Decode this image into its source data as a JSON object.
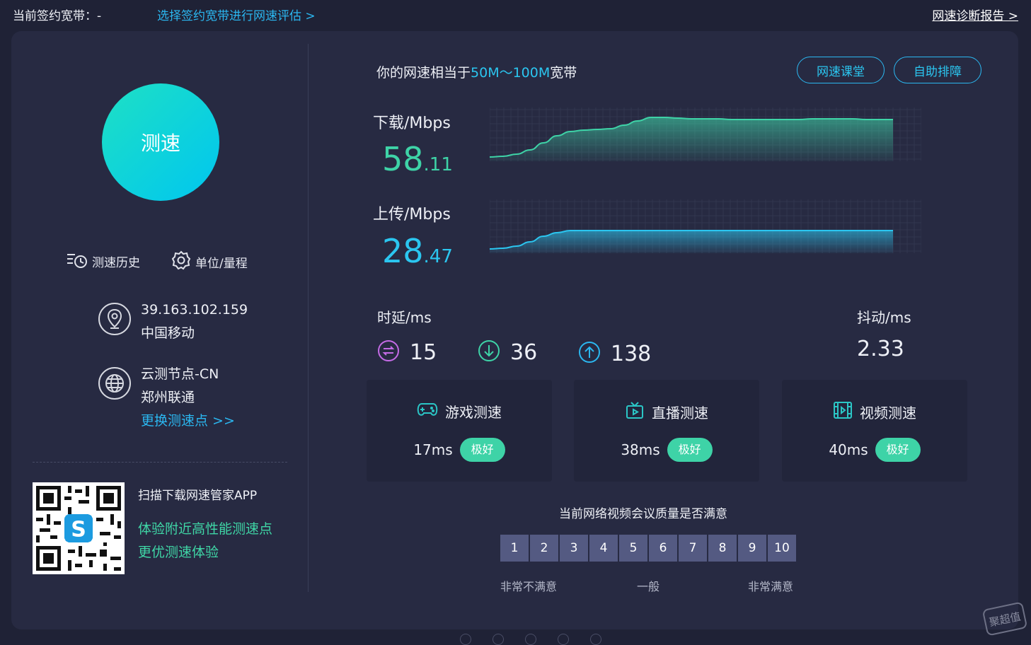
{
  "header": {
    "contract_label": "当前签约宽带：-",
    "select_link": "选择签约宽带进行网速评估 >",
    "report_link": "网速诊断报告 >"
  },
  "left": {
    "speed_button": "测速",
    "history_label": "测速历史",
    "units_label": "单位/量程",
    "ip": "39.163.102.159",
    "isp": "中国移动",
    "node_name": "云测节点-CN",
    "node_city": "郑州联通",
    "change_node": "更换测速点 >>",
    "qr_title": "扫描下载网速管家APP",
    "qr_line1": "体验附近高性能测速点",
    "qr_line2": "更优测速体验"
  },
  "right": {
    "equiv_prefix": "你的网速相当于",
    "equiv_value": "50M～100M",
    "equiv_suffix": "宽带",
    "btn_class": "网速课堂",
    "btn_troubleshoot": "自助排障",
    "download_label": "下载/Mbps",
    "download_int": "58",
    "download_dec": ".11",
    "upload_label": "上传/Mbps",
    "upload_int": "28",
    "upload_dec": ".47",
    "latency_label": "时延/ms",
    "latency_idle": "15",
    "latency_down": "36",
    "latency_up": "138",
    "jitter_label": "抖动/ms",
    "jitter_value": "2.33"
  },
  "scenarios": [
    {
      "title": "游戏测速",
      "value": "17ms",
      "grade": "极好"
    },
    {
      "title": "直播测速",
      "value": "38ms",
      "grade": "极好"
    },
    {
      "title": "视频测速",
      "value": "40ms",
      "grade": "极好"
    }
  ],
  "survey": {
    "question": "当前网络视频会议质量是否满意",
    "scores": [
      "1",
      "2",
      "3",
      "4",
      "5",
      "6",
      "7",
      "8",
      "9",
      "10"
    ],
    "low_label": "非常不满意",
    "mid_label": "一般",
    "high_label": "非常满意"
  },
  "colors": {
    "accent_blue": "#2bb7f0",
    "download_green": "#3ed3a7",
    "upload_blue": "#2bc6f0",
    "badge_green": "#3ed3a7"
  },
  "chart_data": [
    {
      "type": "area",
      "series": [
        {
          "values": [
            2,
            3,
            6,
            12,
            22,
            32,
            38,
            40,
            41,
            42,
            47,
            53,
            58,
            58,
            57,
            56,
            56,
            56,
            55,
            55,
            55,
            55,
            55,
            55,
            56,
            56,
            56,
            56,
            55,
            55,
            55
          ]
        }
      ]
    },
    {
      "type": "area",
      "series": [
        {
          "values": [
            2,
            3,
            6,
            12,
            20,
            25,
            28,
            28,
            28,
            28,
            28,
            28,
            28,
            28,
            28,
            28,
            28,
            28,
            28,
            28,
            28,
            28,
            28,
            28,
            28,
            28,
            28,
            28,
            28,
            28,
            28
          ]
        }
      ]
    }
  ],
  "watermark": "聚超值"
}
